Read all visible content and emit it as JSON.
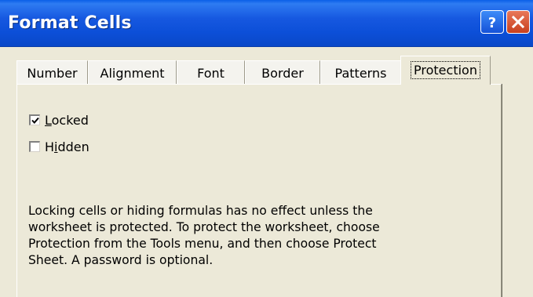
{
  "window": {
    "title": "Format Cells",
    "help_icon": "help-icon",
    "close_icon": "close-icon"
  },
  "tabs": [
    {
      "label": "Number",
      "active": false
    },
    {
      "label": "Alignment",
      "active": false
    },
    {
      "label": "Font",
      "active": false
    },
    {
      "label": "Border",
      "active": false
    },
    {
      "label": "Patterns",
      "active": false
    },
    {
      "label": "Protection",
      "active": true
    }
  ],
  "protection": {
    "locked": {
      "pre": "",
      "accel": "L",
      "post": "ocked",
      "checked": true
    },
    "hidden": {
      "pre": "H",
      "accel": "i",
      "post": "dden",
      "checked": false
    },
    "description_lines": [
      "Locking cells or hiding formulas has no effect unless the",
      "worksheet is protected. To protect the worksheet, choose",
      "Protection from the Tools menu, and then choose Protect",
      "Sheet. A password is optional."
    ]
  },
  "colors": {
    "titlebar": "#0C4FD8",
    "dialog_face": "#ECE9D8",
    "close_button": "#C8401E"
  }
}
